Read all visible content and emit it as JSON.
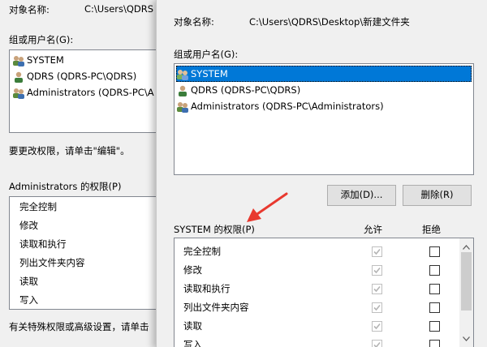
{
  "back": {
    "object_label": "对象名称:",
    "object_path": "C:\\Users\\QDRS",
    "group_label": "组或用户名(G):",
    "users": [
      "SYSTEM",
      "QDRS (QDRS-PC\\QDRS)",
      "Administrators (QDRS-PC\\A"
    ],
    "edit_hint": "要更改权限，请单击\"编辑\"。",
    "perm_title": "Administrators 的权限(P)",
    "perms": [
      "完全控制",
      "修改",
      "读取和执行",
      "列出文件夹内容",
      "读取",
      "写入"
    ],
    "special_hint": "有关特殊权限或高级设置，请单击"
  },
  "front": {
    "object_label": "对象名称:",
    "object_path": "C:\\Users\\QDRS\\Desktop\\新建文件夹",
    "group_label": "组或用户名(G):",
    "users": [
      {
        "name": "SYSTEM",
        "selected": true
      },
      {
        "name": "QDRS (QDRS-PC\\QDRS)",
        "selected": false
      },
      {
        "name": "Administrators (QDRS-PC\\Administrators)",
        "selected": false
      }
    ],
    "add_label": "添加(D)...",
    "remove_label": "删除(R)",
    "perm_title": "SYSTEM 的权限(P)",
    "allow_header": "允许",
    "deny_header": "拒绝",
    "perms": [
      {
        "name": "完全控制",
        "allow": true,
        "deny": false
      },
      {
        "name": "修改",
        "allow": true,
        "deny": false
      },
      {
        "name": "读取和执行",
        "allow": true,
        "deny": false
      },
      {
        "name": "列出文件夹内容",
        "allow": true,
        "deny": false
      },
      {
        "name": "读取",
        "allow": true,
        "deny": false
      },
      {
        "name": "写入",
        "allow": true,
        "deny": false
      }
    ]
  },
  "colors": {
    "selection": "#0078d7",
    "arrow": "#e8392f"
  }
}
